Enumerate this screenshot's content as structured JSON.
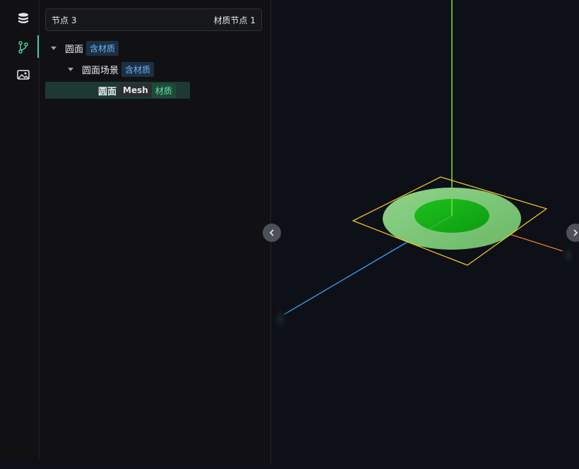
{
  "sidebar": {
    "icons": [
      "database-icon",
      "branch-icon",
      "image-icon"
    ],
    "active_index": 1,
    "accent": "#3fd19a"
  },
  "breadcrumb": {
    "left": "节点 3",
    "right": "材质节点 1"
  },
  "tree": {
    "root": {
      "label": "圆面",
      "tag": "含材质"
    },
    "child": {
      "label": "圆面场景",
      "tag": "含材质"
    },
    "leaf": {
      "label": "圆面",
      "tag_type": "Mesh",
      "tag_material": "材质"
    }
  },
  "viewport": {
    "axis_colors": {
      "y": "#7ee23a",
      "x": "#f07a26",
      "z": "#2f96e8"
    },
    "bbox_color": "#f0c020",
    "disc_colors": {
      "outer": "#7fcf7a",
      "inner": "#19b51b"
    }
  }
}
